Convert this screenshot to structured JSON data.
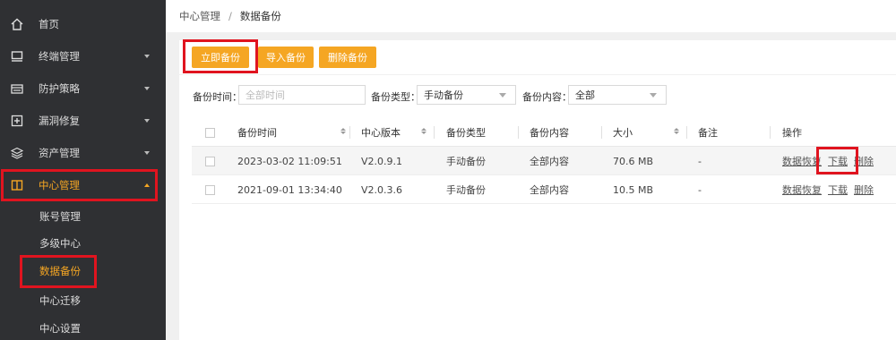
{
  "sidebar": {
    "items": [
      {
        "label": "首页",
        "icon": "home-icon"
      },
      {
        "label": "终端管理",
        "icon": "monitor-icon"
      },
      {
        "label": "防护策略",
        "icon": "strategy-icon"
      },
      {
        "label": "漏洞修复",
        "icon": "patch-icon"
      },
      {
        "label": "资产管理",
        "icon": "layers-icon"
      },
      {
        "label": "中心管理",
        "icon": "book-icon"
      }
    ],
    "subitems": [
      {
        "label": "账号管理"
      },
      {
        "label": "多级中心"
      },
      {
        "label": "数据备份"
      },
      {
        "label": "中心迁移"
      },
      {
        "label": "中心设置"
      }
    ]
  },
  "breadcrumb": {
    "parent": "中心管理",
    "separator": "/",
    "current": "数据备份"
  },
  "toolbar": {
    "backup_now": "立即备份",
    "import_backup": "导入备份",
    "delete_backup": "删除备份"
  },
  "filters": {
    "time_label": "备份时间：",
    "time_placeholder": "全部时间",
    "type_label": "备份类型：",
    "type_value": "手动备份",
    "content_label": "备份内容：",
    "content_value": "全部"
  },
  "table": {
    "headers": [
      "备份时间",
      "中心版本",
      "备份类型",
      "备份内容",
      "大小",
      "备注",
      "操作"
    ],
    "rows": [
      {
        "time": "2023-03-02 11:09:51",
        "version": "V2.0.9.1",
        "type": "手动备份",
        "content": "全部内容",
        "size": "70.6 MB",
        "note": "-"
      },
      {
        "time": "2021-09-01 13:34:40",
        "version": "V2.0.3.6",
        "type": "手动备份",
        "content": "全部内容",
        "size": "10.5 MB",
        "note": "-"
      }
    ],
    "actions": {
      "restore": "数据恢复",
      "download": "下载",
      "delete": "删除"
    }
  },
  "colors": {
    "accent": "#f5a623",
    "sidebar_bg": "#2f3033",
    "highlight_box": "#e0141f"
  }
}
